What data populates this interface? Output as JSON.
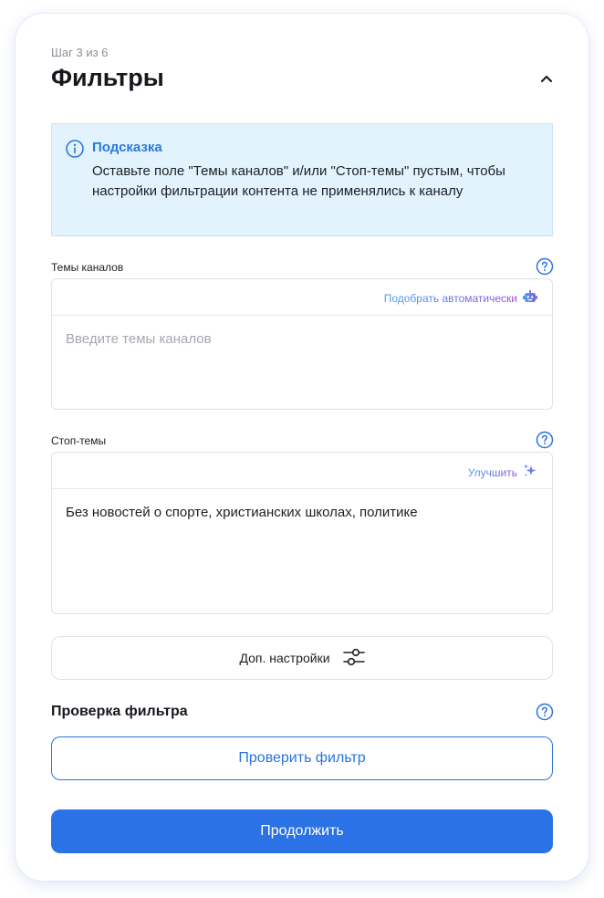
{
  "step": "Шаг 3 из 6",
  "title": "Фильтры",
  "hint": {
    "title": "Подсказка",
    "text": "Оставьте поле \"Темы каналов\" и/или \"Стоп-темы\" пустым, чтобы настройки фильтрации контента не применялись к каналу"
  },
  "channel_topics": {
    "label": "Темы каналов",
    "action": "Подобрать автоматически",
    "placeholder": "Введите темы каналов",
    "value": ""
  },
  "stop_topics": {
    "label": "Стоп-темы",
    "action": "Улучшить",
    "value": "Без новостей о спорте, христианских школах, политике"
  },
  "advanced_settings_label": "Доп. настройки",
  "filter_check": {
    "title": "Проверка фильтра",
    "button": "Проверить фильтр"
  },
  "continue_label": "Продолжить",
  "colors": {
    "accent": "#2a72e6",
    "hint_bg": "#e3f3fd",
    "hint_title": "#2a7ad9"
  }
}
